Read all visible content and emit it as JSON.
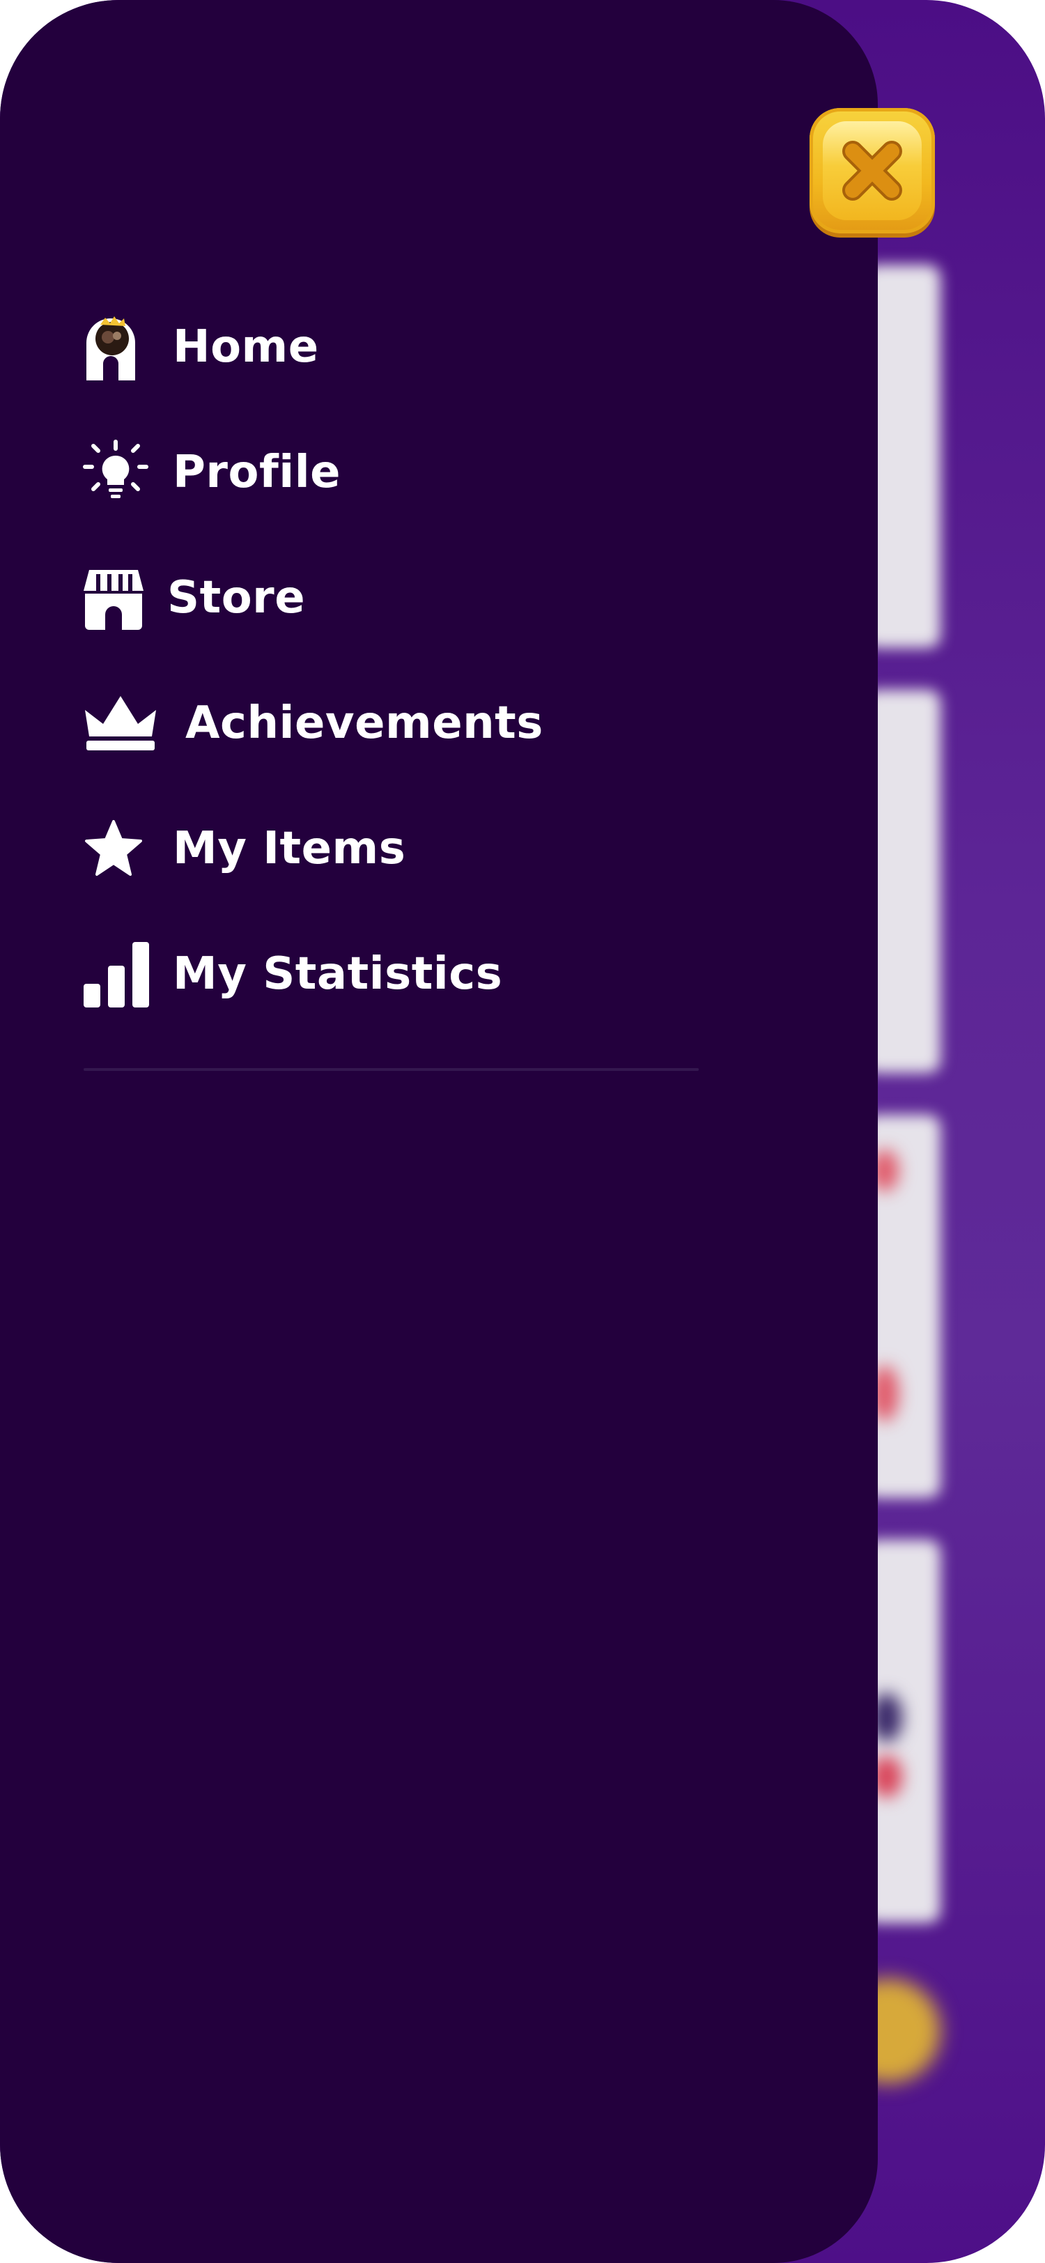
{
  "background": {
    "gradient_color": "#5d2596"
  },
  "drawer": {
    "background_color": "#23003d",
    "close_button": {
      "icon": "close-icon",
      "color": "#f2b81f"
    },
    "menu": [
      {
        "id": "home",
        "label": "Home",
        "icon": "home-avatar-icon"
      },
      {
        "id": "profile",
        "label": "Profile",
        "icon": "lightbulb-icon"
      },
      {
        "id": "store",
        "label": "Store",
        "icon": "store-icon"
      },
      {
        "id": "achievements",
        "label": "Achievements",
        "icon": "crown-icon"
      },
      {
        "id": "my-items",
        "label": "My Items",
        "icon": "star-icon"
      },
      {
        "id": "my-statistics",
        "label": "My Statistics",
        "icon": "bar-chart-icon"
      }
    ]
  }
}
